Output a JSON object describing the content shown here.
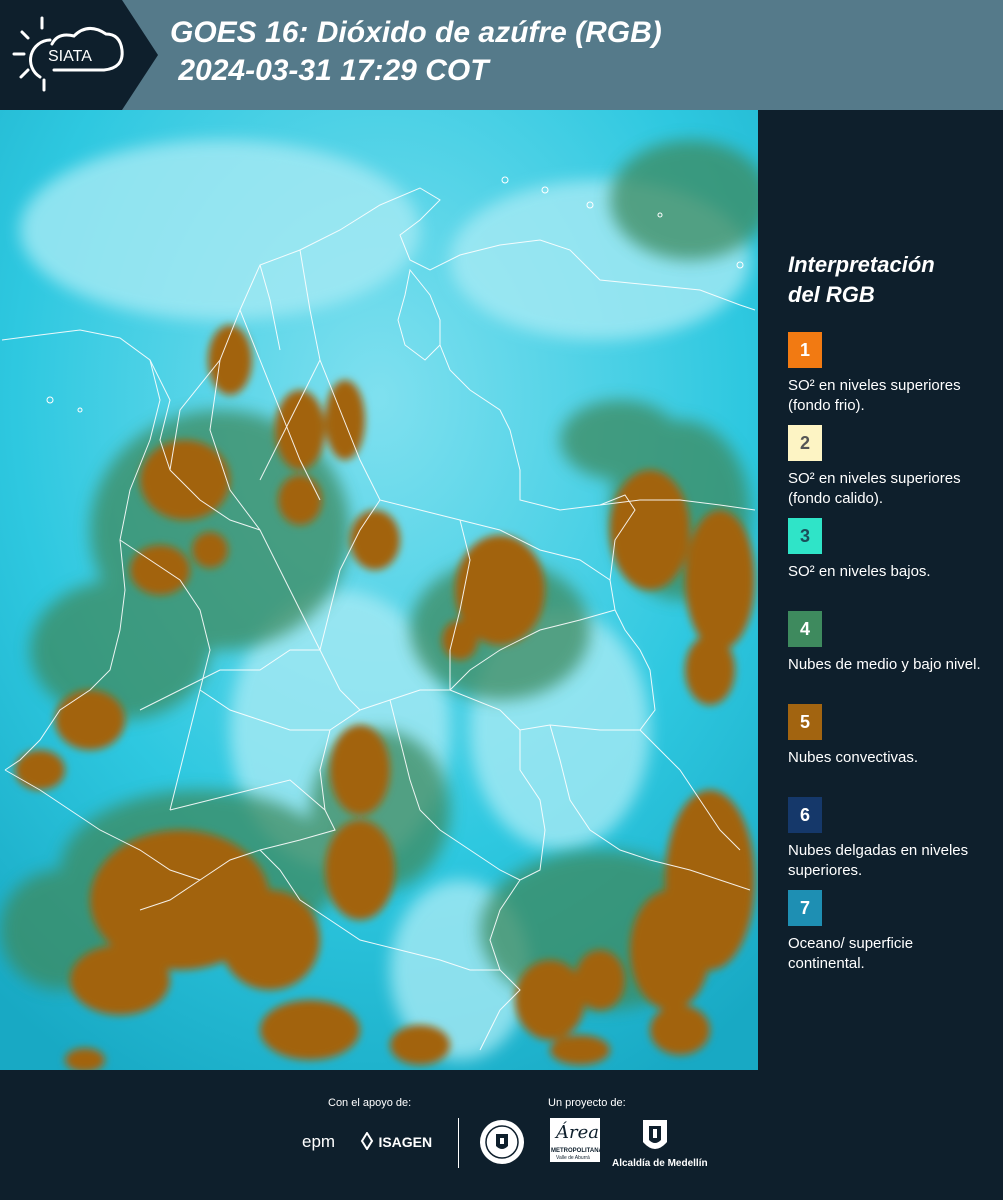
{
  "header": {
    "logo_text": "SIATA",
    "title_line1": "GOES 16: Dióxido de azúfre (RGB)",
    "title_line2": " 2024-03-31 17:29 COT"
  },
  "legend": {
    "title_line1": "Interpretación",
    "title_line2": "del RGB",
    "items": [
      {
        "num": "1",
        "color": "#f27a12",
        "num_color": "#ffffff",
        "label": "SO² en niveles superiores (fondo frio)."
      },
      {
        "num": "2",
        "color": "#fdf4c4",
        "num_color": "#555555",
        "label": "SO² en niveles superiores (fondo calido)."
      },
      {
        "num": "3",
        "color": "#2fe4c8",
        "num_color": "#1a4f5a",
        "label": "SO² en niveles bajos."
      },
      {
        "num": "4",
        "color": "#3e8a5e",
        "num_color": "#ffffff",
        "label": "Nubes de medio y bajo nivel."
      },
      {
        "num": "5",
        "color": "#a26410",
        "num_color": "#ffffff",
        "label": "Nubes convectivas."
      },
      {
        "num": "6",
        "color": "#15386a",
        "num_color": "#ffffff",
        "label": "Nubes delgadas en niveles superiores."
      },
      {
        "num": "7",
        "color": "#1e8fb3",
        "num_color": "#ffffff",
        "label": "Oceano/ superficie continental."
      }
    ]
  },
  "footer": {
    "support_label": "Con el apoyo de:",
    "project_label": "Un proyecto de:",
    "epm": "epm",
    "isagen": "ISAGEN",
    "metropolitana": "METROPOLITANA",
    "metro_sub": "Valle de Aburrá",
    "area_script": "Área",
    "alcaldia": "Alcaldía de Medellín"
  },
  "colors": {
    "header_bg": "#557a8a",
    "page_bg": "#0e1f2c",
    "map_ocean": "#26c6de",
    "map_clear": "#8fe3f0",
    "map_convective": "#a26410",
    "map_midlevel": "#3e8a5e",
    "borders": "#ffffff"
  }
}
